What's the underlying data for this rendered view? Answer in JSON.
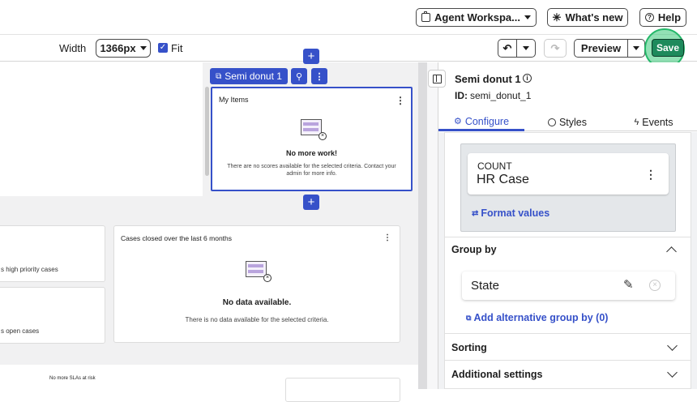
{
  "header": {
    "workspace_label": "Agent Workspa...",
    "whats_new_label": "What's new",
    "help_label": "Help"
  },
  "toolbar": {
    "width_label": "Width",
    "width_value": "1366px",
    "fit_label": "Fit",
    "fit_checked": true,
    "preview_label": "Preview",
    "save_label": "Save"
  },
  "canvas": {
    "selected_chip_label": "Semi donut 1",
    "widget_my_items": {
      "title": "My Items",
      "empty_title": "No more work!",
      "empty_text": "There are no scores available for the selected criteria. Contact your admin for more info."
    },
    "partial_card_1_text": "s high priority cases",
    "partial_card_2_text": "s open cases",
    "widget_cases_closed": {
      "title": "Cases closed over the last 6 months",
      "empty_title": "No data available.",
      "empty_text": "There is no data available for the selected criteria."
    },
    "sla_text": "No more SLAs at risk"
  },
  "panel": {
    "title": "Semi donut 1",
    "id_label": "ID:",
    "id_value": "semi_donut_1",
    "tabs": [
      {
        "label": "Configure",
        "active": true
      },
      {
        "label": "Styles",
        "active": false
      },
      {
        "label": "Events",
        "active": false
      }
    ],
    "metric": {
      "aggregate": "COUNT",
      "table": "HR Case"
    },
    "format_values_label": "Format values",
    "group_by": {
      "heading": "Group by",
      "field": "State",
      "add_alt_label": "Add alternative group by (0)"
    },
    "sorting_label": "Sorting",
    "additional_label": "Additional settings"
  },
  "colors": {
    "accent_blue": "#3651c9",
    "save_green": "#1e8a5c",
    "canvas_bg": "#f1f1f2",
    "panel_gray": "#e6e8ea"
  }
}
